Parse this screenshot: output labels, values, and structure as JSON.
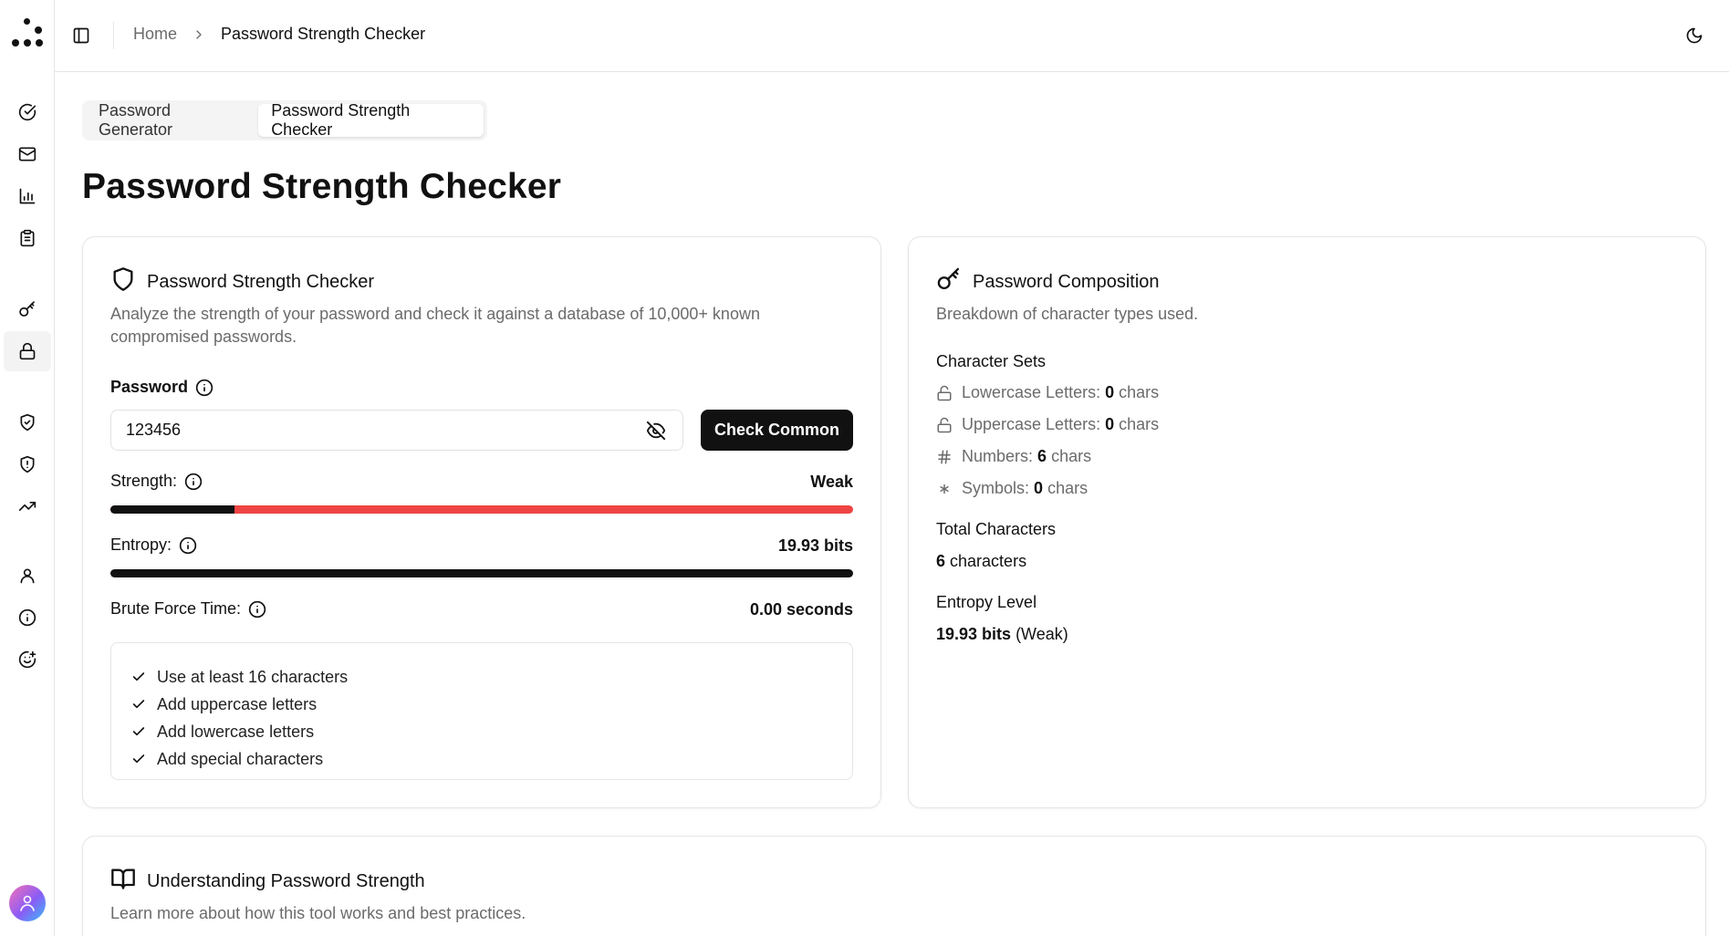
{
  "header": {
    "breadcrumb_home": "Home",
    "breadcrumb_current": "Password Strength Checker"
  },
  "tabs": [
    {
      "label": "Password Generator",
      "active": false
    },
    {
      "label": "Password Strength Checker",
      "active": true
    }
  ],
  "page_title": "Password Strength Checker",
  "checker": {
    "title": "Password Strength Checker",
    "description": "Analyze the strength of your password and check it against a database of 10,000+ known compromised passwords.",
    "password_label": "Password",
    "password_value": "123456",
    "check_button": "Check Common",
    "strength_label": "Strength:",
    "strength_value": "Weak",
    "strength_fraction": 0.167,
    "entropy_label": "Entropy:",
    "entropy_value": "19.93 bits",
    "brute_force_label": "Brute Force Time:",
    "brute_force_value": "0.00 seconds",
    "tips": [
      "Use at least 16 characters",
      "Add uppercase letters",
      "Add lowercase letters",
      "Add special characters"
    ]
  },
  "composition": {
    "title": "Password Composition",
    "description": "Breakdown of character types used.",
    "char_sets_title": "Character Sets",
    "sets": [
      {
        "label": "Lowercase Letters:",
        "count": "0",
        "unit": "chars",
        "icon": "lock-open-icon"
      },
      {
        "label": "Uppercase Letters:",
        "count": "0",
        "unit": "chars",
        "icon": "lock-open-icon"
      },
      {
        "label": "Numbers:",
        "count": "6",
        "unit": "chars",
        "icon": "hash-icon"
      },
      {
        "label": "Symbols:",
        "count": "0",
        "unit": "chars",
        "icon": "asterisk-icon"
      }
    ],
    "total_title": "Total Characters",
    "total_count": "6",
    "total_unit": "characters",
    "entropy_title": "Entropy Level",
    "entropy_value": "19.93 bits",
    "entropy_rating": "(Weak)"
  },
  "understanding": {
    "title": "Understanding Password Strength",
    "description": "Learn more about how this tool works and best practices."
  },
  "colors": {
    "accent": "#111111",
    "weak": "#ef4444",
    "muted_text": "#6b6b6b",
    "border": "#e5e5e5"
  }
}
